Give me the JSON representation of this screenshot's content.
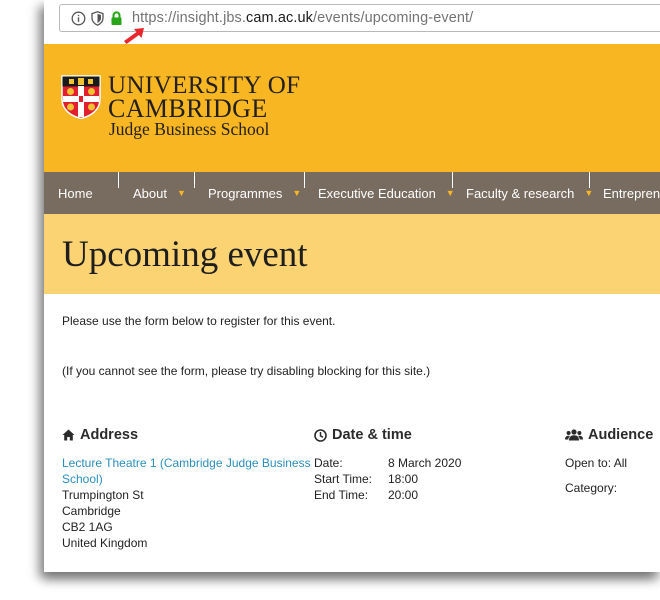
{
  "browser": {
    "url_prefix": "https://insight.jbs.",
    "url_host": "cam.ac.uk",
    "url_path": "/events/upcoming-event/"
  },
  "header": {
    "logo_line1": "UNIVERSITY OF",
    "logo_line2": "CAMBRIDGE",
    "logo_line3": "Judge Business School"
  },
  "nav": {
    "items": [
      {
        "label": "Home"
      },
      {
        "label": "About"
      },
      {
        "label": "Programmes"
      },
      {
        "label": "Executive Education"
      },
      {
        "label": "Faculty & research"
      },
      {
        "label": "Entreprene"
      }
    ]
  },
  "page": {
    "title": "Upcoming event",
    "intro": "Please use the form below to register for this event.",
    "note": "(If you cannot see the form, please try disabling blocking for this site.)"
  },
  "address": {
    "heading": "Address",
    "venue": "Lecture Theatre 1 (Cambridge Judge Business School)",
    "line1": "Trumpington St",
    "line2": "Cambridge",
    "line3": "CB2 1AG",
    "line4": "United Kingdom"
  },
  "datetime": {
    "heading": "Date & time",
    "date_label": "Date:",
    "date_value": "8 March 2020",
    "start_label": "Start Time:",
    "start_value": "18:00",
    "end_label": "End Time:",
    "end_value": "20:00"
  },
  "audience": {
    "heading": "Audience",
    "open_to": "Open to: All",
    "category": "Category:"
  },
  "colors": {
    "header_bg": "#f8b622",
    "nav_bg": "#786b5f",
    "title_band": "#fcd372",
    "link": "#2a8fbd",
    "arrow": "#e8262b",
    "lock": "#26a516"
  },
  "icons": [
    "info-icon",
    "shield-icon",
    "lock-icon",
    "red-arrow-icon",
    "home-icon",
    "clock-icon",
    "users-icon"
  ]
}
